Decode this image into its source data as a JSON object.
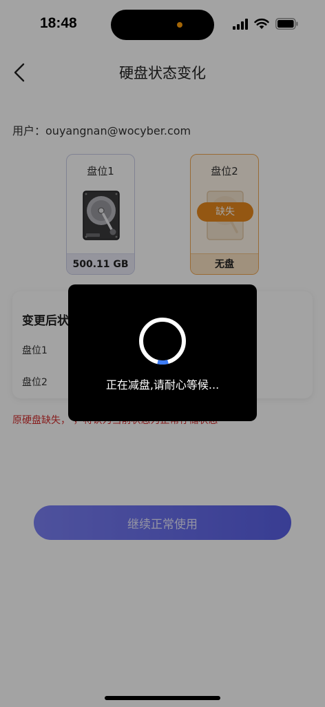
{
  "status_bar": {
    "time": "18:48"
  },
  "header": {
    "title": "硬盘状态变化"
  },
  "user": {
    "label": "用户：",
    "email": "ouyangnan@wocyber.com"
  },
  "slots": [
    {
      "title": "盘位1",
      "footer": "500.11 GB",
      "state": "present"
    },
    {
      "title": "盘位2",
      "footer": "无盘",
      "badge": "缺失",
      "state": "missing"
    }
  ],
  "status_card": {
    "title": "变更后状",
    "rows": [
      {
        "label": "盘位1"
      },
      {
        "label": "盘位2"
      }
    ]
  },
  "warning": "原硬盘缺失，                                                  ，将认为当前状态为正常存储状态",
  "actions": {
    "continue_label": "继续正常使用"
  },
  "loading": {
    "text": "正在减盘,请耐心等候...",
    "progress_color": "#3d7cf5"
  },
  "colors": {
    "accent": "#6369ee",
    "warning": "#d32f2f",
    "missing": "#e8891d"
  }
}
